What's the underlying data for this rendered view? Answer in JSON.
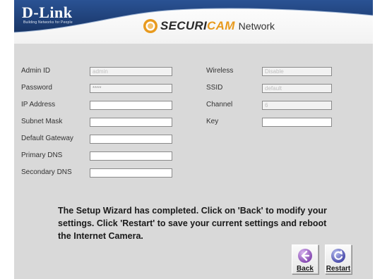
{
  "header": {
    "logo": "D-Link",
    "logo_tagline": "Building Networks for People",
    "brand_prefix": "SECURI",
    "brand_highlight": "CAM",
    "brand_suffix": "Network",
    "colors": {
      "band": "#1d3f7a",
      "brand_orange": "#e89a1e"
    }
  },
  "form": {
    "admin_id": {
      "label": "Admin ID",
      "value": "admin"
    },
    "password": {
      "label": "Password",
      "value": "****"
    },
    "ip_address": {
      "label": "IP Address",
      "value": ""
    },
    "subnet_mask": {
      "label": "Subnet Mask",
      "value": ""
    },
    "default_gateway": {
      "label": "Default Gateway",
      "value": ""
    },
    "primary_dns": {
      "label": "Primary DNS",
      "value": ""
    },
    "secondary_dns": {
      "label": "Secondary DNS",
      "value": ""
    },
    "wireless": {
      "label": "Wireless",
      "value": "Disable"
    },
    "ssid": {
      "label": "SSID",
      "value": "default"
    },
    "channel": {
      "label": "Channel",
      "value": "6"
    },
    "key": {
      "label": "Key",
      "value": ""
    }
  },
  "message": "The Setup Wizard has completed. Click on 'Back' to modify your settings. Click 'Restart' to save your current settings and reboot the Internet Camera.",
  "buttons": {
    "back": {
      "label": "Back",
      "icon": "back-arrow-icon"
    },
    "restart": {
      "label": "Restart",
      "icon": "restart-icon"
    }
  }
}
